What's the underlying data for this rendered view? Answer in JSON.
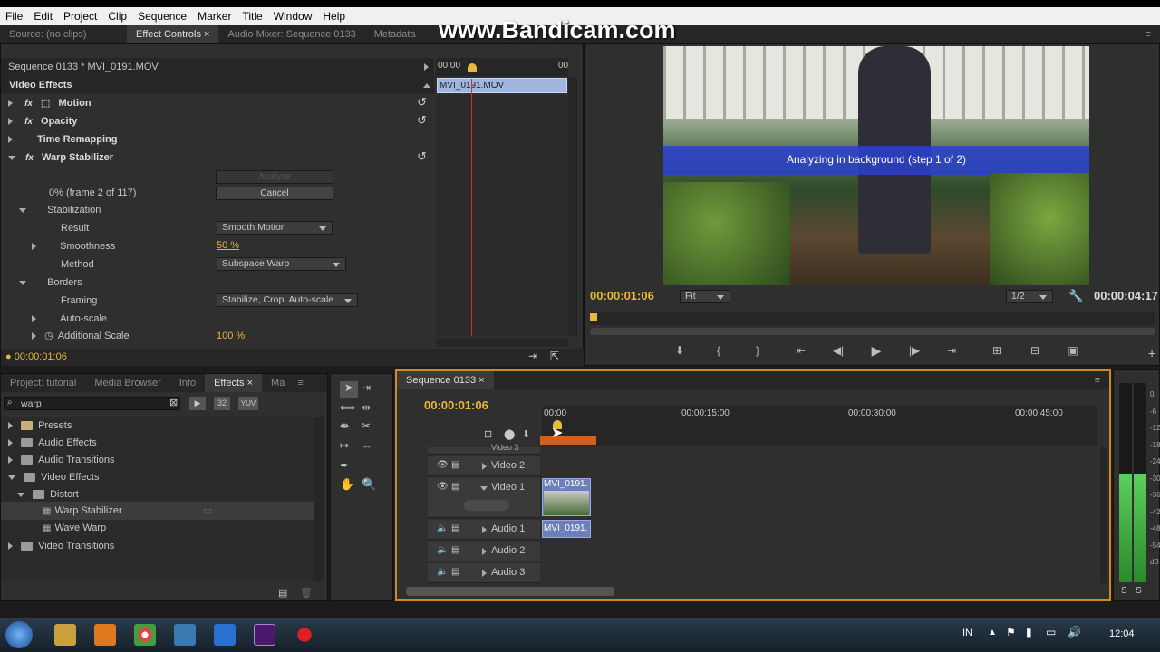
{
  "menu": [
    "File",
    "Edit",
    "Project",
    "Clip",
    "Sequence",
    "Marker",
    "Title",
    "Window",
    "Help"
  ],
  "watermark": "www.Bandicam.com",
  "top_tabs": {
    "source": "Source: (no clips)",
    "effect_controls": "Effect Controls",
    "audio_mixer": "Audio Mixer: Sequence 0133",
    "metadata": "Metadata"
  },
  "effect_controls": {
    "sequence_label": "Sequence 0133 * MVI_0191.MOV",
    "mini_timecode": "00:00",
    "mini_timecode_end": "00",
    "clip_label": "MVI_0191.MOV",
    "video_effects": "Video Effects",
    "motion": "Motion",
    "opacity": "Opacity",
    "time_remapping": "Time Remapping",
    "warp_stabilizer": "Warp Stabilizer",
    "analyze_btn": "Analyze",
    "progress": "0% (frame 2 of 117)",
    "cancel_btn": "Cancel",
    "stabilization": "Stabilization",
    "result_label": "Result",
    "result_value": "Smooth Motion",
    "smoothness_label": "Smoothness",
    "smoothness_value": "50 %",
    "method_label": "Method",
    "method_value": "Subspace Warp",
    "borders": "Borders",
    "framing_label": "Framing",
    "framing_value": "Stabilize, Crop, Auto-scale",
    "autoscale_label": "Auto-scale",
    "additional_scale_label": "Additional Scale",
    "additional_scale_value": "100 %",
    "footer_timecode": "00:00:01:06"
  },
  "program": {
    "overlay_text": "Analyzing in background (step 1 of 2)",
    "timecode_current": "00:00:01:06",
    "zoom": "Fit",
    "resolution": "1/2",
    "timecode_duration": "00:00:04:17"
  },
  "project_tabs": {
    "project": "Project: tutorial",
    "media_browser": "Media Browser",
    "info": "Info",
    "effects": "Effects",
    "markers": "Ma"
  },
  "effects_panel": {
    "search_value": "warp",
    "badge1": "32",
    "badge2": "YUV",
    "items": {
      "presets": "Presets",
      "audio_effects": "Audio Effects",
      "audio_transitions": "Audio Transitions",
      "video_effects": "Video Effects",
      "distort": "Distort",
      "warp_stabilizer": "Warp Stabilizer",
      "wave_warp": "Wave Warp",
      "video_transitions": "Video Transitions"
    }
  },
  "timeline": {
    "tab": "Sequence 0133",
    "timecode": "00:00:01:06",
    "ruler": [
      "00:00",
      "00:00:15:00",
      "00:00:30:00",
      "00:00:45:00"
    ],
    "tracks": {
      "video3": "Video 3",
      "video2": "Video 2",
      "video1": "Video 1",
      "audio1": "Audio 1",
      "audio2": "Audio 2",
      "audio3": "Audio 3"
    },
    "video_clip": "MVI_0191.",
    "audio_clip": "MVI_0191."
  },
  "meter": {
    "labels": [
      "0",
      "-6",
      "-12",
      "-18",
      "-24",
      "-30",
      "-36",
      "-42",
      "-48",
      "-54",
      "dB"
    ],
    "solo_left": "S",
    "solo_right": "S"
  },
  "taskbar": {
    "lang": "IN",
    "clock": "12:04"
  },
  "colors": {
    "accent_timecode": "#e8b83a",
    "overlay_band": "#2a3fd0",
    "clip": "#6c7fb8",
    "playhead": "#d03030"
  }
}
